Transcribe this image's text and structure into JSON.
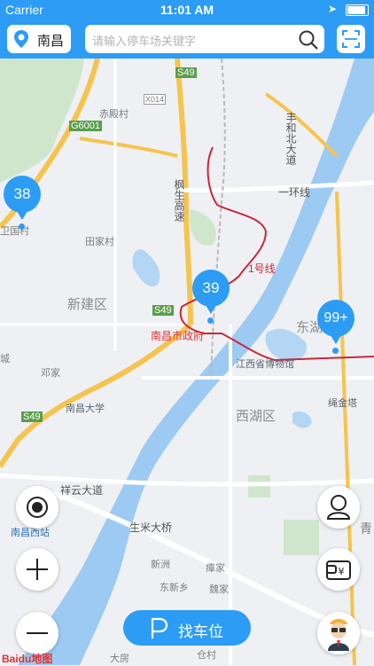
{
  "status": {
    "carrier": "Carrier",
    "time": "11:01 AM"
  },
  "header": {
    "city": "南昌",
    "search_placeholder": "请输入停车场关键字"
  },
  "map": {
    "labels": {
      "xinjian": "新建区",
      "xihu": "西湖区",
      "dong": "东湖",
      "gov": "南昌市政府",
      "museum": "江西省博物馆",
      "shengjin": "绳金塔",
      "ncu": "南昌大学",
      "chimen": "赤殿村",
      "tianjia": "田家村",
      "dengjia": "邓家",
      "line1": "1号线",
      "ring1": "一环线",
      "xiangyun": "祥云大道",
      "shengmi": "生米大桥",
      "fengbei": "丰和北大道",
      "fengsheng": "枫生高速",
      "s49a": "S49",
      "s49b": "S49",
      "s49c": "S49",
      "g6001": "G6001",
      "x014": "X014",
      "nanchangxi": "南昌西站",
      "xinzhou": "新洲",
      "dongxinxiang": "东新乡",
      "linjia": "瘴家",
      "weijia": "魏家",
      "cangtou": "仓村",
      "dafang": "大房",
      "qing": "青",
      "liucun": "卫国村",
      "cheng": "城"
    },
    "markers": [
      {
        "count": "38"
      },
      {
        "count": "39"
      },
      {
        "count": "99+"
      }
    ]
  },
  "actions": {
    "find_parking": "找车位"
  },
  "logo": {
    "text": "Baidu地图"
  },
  "colors": {
    "accent": "#2c9cf5",
    "metro": "#c8283c",
    "water": "#9ccaf2",
    "road": "#f6c44e"
  }
}
